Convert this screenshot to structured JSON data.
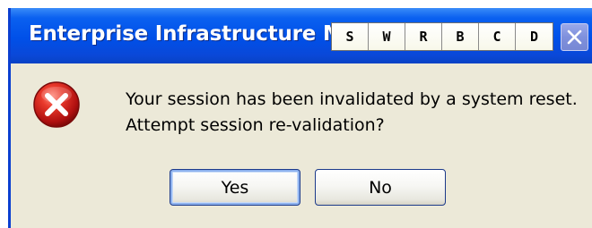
{
  "dialog": {
    "title": "Enterprise Infrastructure M",
    "message_line1": "Your session has been invalidated by a system reset.",
    "message_line2": "Attempt session re-validation?",
    "icon": "error-icon",
    "buttons": {
      "yes": "Yes",
      "no": "No"
    }
  },
  "overlay_tabs": [
    "S",
    "W",
    "R",
    "B",
    "C",
    "D"
  ],
  "colors": {
    "titlebar": "#0050e8",
    "dialog_background": "#ece9d8",
    "error_red": "#c8102e"
  }
}
